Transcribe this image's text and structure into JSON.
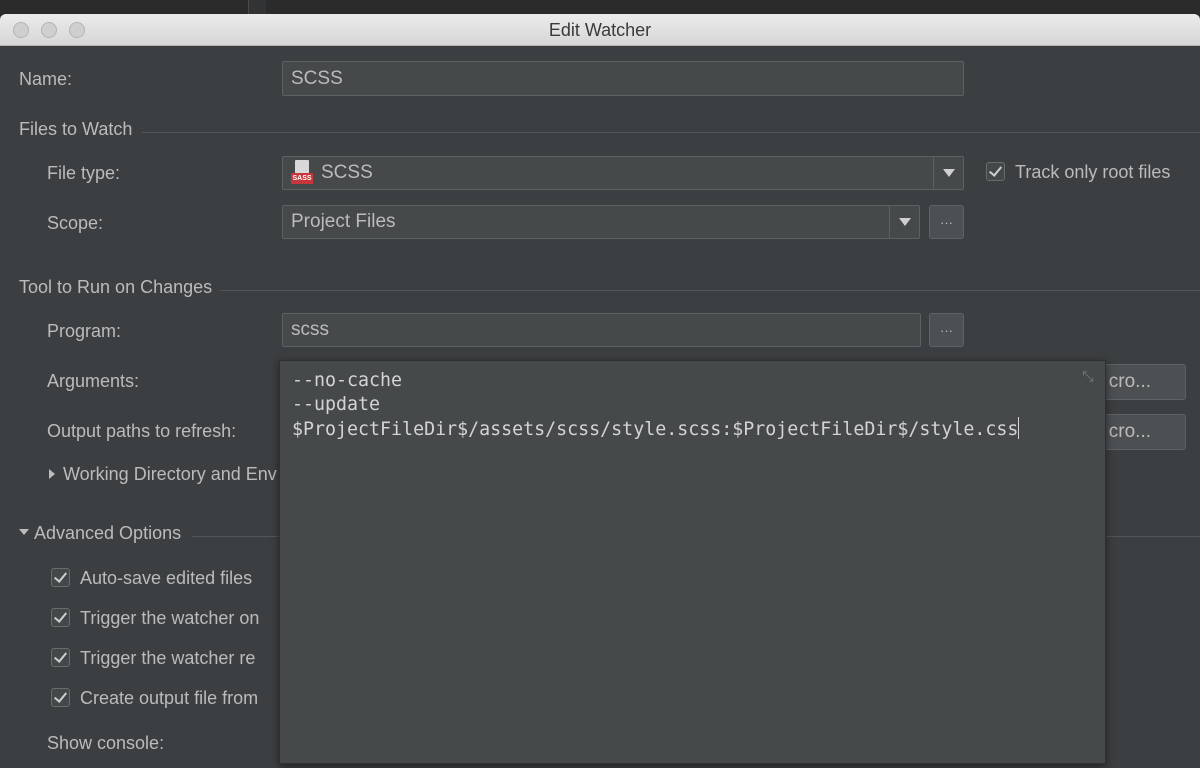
{
  "window": {
    "title": "Edit Watcher"
  },
  "name": {
    "label": "Name:",
    "value": "SCSS"
  },
  "files_to_watch": {
    "header": "Files to Watch",
    "file_type": {
      "label": "File type:",
      "value": "SCSS",
      "icon": "sass-file-icon"
    },
    "track_only_root": {
      "label": "Track only root files",
      "checked": true
    },
    "scope": {
      "label": "Scope:",
      "value": "Project Files",
      "ellipsis": "···"
    }
  },
  "tool": {
    "header": "Tool to Run on Changes",
    "program": {
      "label": "Program:",
      "value": "scss",
      "ellipsis": "···"
    },
    "arguments": {
      "label": "Arguments:",
      "macro_label": "cro..."
    },
    "output_paths": {
      "label": "Output paths to refresh:",
      "macro_label": "cro..."
    },
    "working_dir": {
      "label": "Working Directory and Env"
    }
  },
  "advanced": {
    "header": "Advanced Options",
    "options": [
      {
        "label": "Auto-save edited files",
        "checked": true
      },
      {
        "label": "Trigger the watcher on",
        "checked": true
      },
      {
        "label": "Trigger the watcher re",
        "checked": true
      },
      {
        "label": "Create output file from",
        "checked": true
      }
    ],
    "show_console": {
      "label": "Show console:"
    }
  },
  "arguments_popup": {
    "lines": [
      "--no-cache",
      "--update",
      "$ProjectFileDir$/assets/scss/style.scss:$ProjectFileDir$/style.css"
    ]
  }
}
